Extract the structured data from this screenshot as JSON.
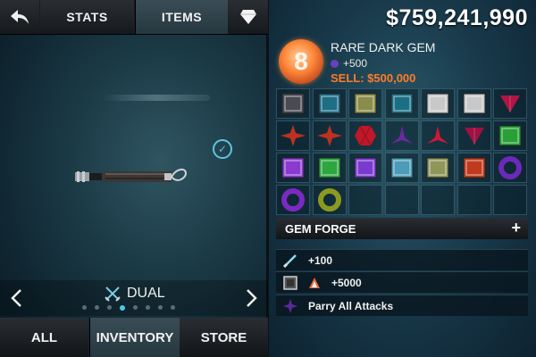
{
  "tabs": {
    "back": "back-arrow-icon",
    "stats": "STATS",
    "items": "ITEMS",
    "gem": "diamond-icon"
  },
  "weapon": {
    "stance": "DUAL"
  },
  "pager": {
    "count": 8,
    "active_index": 3
  },
  "bottom_tabs": {
    "all": "ALL",
    "inventory": "INVENTORY",
    "store": "STORE"
  },
  "money": "$759,241,990",
  "selected_gem": {
    "icon_glyph": "8",
    "name": "RARE DARK GEM",
    "bonus": "+500",
    "sell": "SELL: $500,000"
  },
  "gems": [
    {
      "shape": "square",
      "color": "#4a4a52"
    },
    {
      "shape": "square",
      "color": "#1e6e86"
    },
    {
      "shape": "square",
      "color": "#8a8d4a"
    },
    {
      "shape": "square",
      "color": "#1a6f85"
    },
    {
      "shape": "square",
      "color": "#c8c8c8"
    },
    {
      "shape": "square",
      "color": "#c8c8c8"
    },
    {
      "shape": "triangle-down",
      "color": "#b01545"
    },
    {
      "shape": "star",
      "color": "#c03020"
    },
    {
      "shape": "star",
      "color": "#c03020"
    },
    {
      "shape": "hexagon",
      "color": "#c01828"
    },
    {
      "shape": "star3",
      "color": "#6a2aa0"
    },
    {
      "shape": "star3",
      "color": "#d01838"
    },
    {
      "shape": "triangle-down",
      "color": "#a01040"
    },
    {
      "shape": "square",
      "color": "#28a035"
    },
    {
      "shape": "square",
      "color": "#8a3acf"
    },
    {
      "shape": "square",
      "color": "#2ea640"
    },
    {
      "shape": "square",
      "color": "#7a3ad0"
    },
    {
      "shape": "square",
      "color": "#4a9cb8"
    },
    {
      "shape": "square",
      "color": "#8f965a"
    },
    {
      "shape": "square",
      "color": "#c03a1e"
    },
    {
      "shape": "ring",
      "color": "#6a2ab8"
    },
    {
      "shape": "ring",
      "color": "#7a2ac0"
    },
    {
      "shape": "ring",
      "color": "#8a9a20"
    }
  ],
  "forge": {
    "label": "GEM FORGE",
    "plus": "+"
  },
  "abilities": [
    {
      "icon": "blade-icon",
      "text": "+100"
    },
    {
      "icon": "gem-slot-icon",
      "text": "+5000"
    },
    {
      "icon": "parry-star-icon",
      "text": "Parry All Attacks"
    }
  ]
}
